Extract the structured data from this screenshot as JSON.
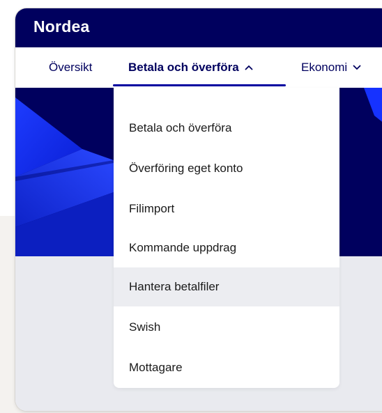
{
  "brand": {
    "logo_text": "Nordea",
    "primary_color": "#00005e",
    "accent_color": "#0000a0"
  },
  "nav": {
    "tabs": [
      {
        "label": "Översikt"
      },
      {
        "label": "Betala och överföra",
        "active": true,
        "chevron": "^"
      },
      {
        "label": "Ekonomi",
        "chevron": "v"
      }
    ]
  },
  "dropdown": {
    "items": [
      {
        "label": "Betala och överföra"
      },
      {
        "label": "Överföring eget konto"
      },
      {
        "label": "Filimport"
      },
      {
        "label": "Kommande uppdrag"
      },
      {
        "label": "Hantera betalfiler",
        "hovered": true
      },
      {
        "label": "Swish"
      },
      {
        "label": "Mottagare"
      }
    ]
  }
}
